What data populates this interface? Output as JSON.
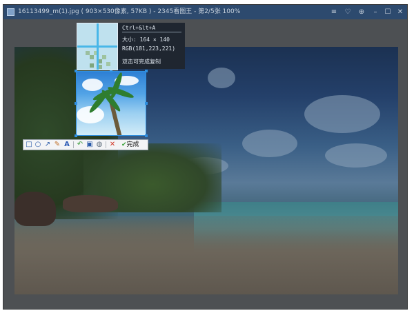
{
  "window": {
    "title": "16113499_m(1).jpg ( 903×530像素, 57KB ) - 2345看图王 - 第2/5张 100%",
    "controls": [
      "≡",
      "♡",
      "⊕",
      "–",
      "☐",
      "✕"
    ]
  },
  "info": {
    "shortcut": "Ctrl+&lt+A",
    "size_label": "大小: 164 × 140",
    "rgb_label": "RGB(181,223,221)",
    "copy_hint": "双击可完成复制"
  },
  "toolbar": {
    "tools": [
      {
        "name": "rectangle-tool",
        "glyph": "□"
      },
      {
        "name": "ellipse-tool",
        "glyph": "○"
      },
      {
        "name": "arrow-tool",
        "glyph": "↗"
      },
      {
        "name": "brush-tool",
        "glyph": "✎"
      },
      {
        "name": "text-tool",
        "glyph": "A"
      },
      {
        "name": "undo-tool",
        "glyph": "↶"
      },
      {
        "name": "save-tool",
        "glyph": "▣"
      },
      {
        "name": "mosaic-tool",
        "glyph": "◍"
      },
      {
        "name": "cancel-tool",
        "glyph": "✕"
      }
    ],
    "done_icon": "✔",
    "done_label": "完成"
  }
}
